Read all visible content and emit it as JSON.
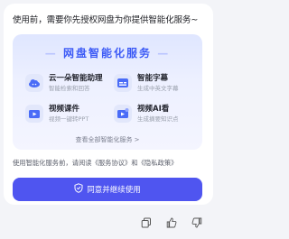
{
  "intro_text": "使用前，需要你先授权网盘为你提供智能化服务~",
  "card": {
    "title": "网盘智能化服务",
    "features": [
      {
        "icon": "cloud-assistant-icon",
        "title": "云一朵智能助理",
        "subtitle": "智能检索和回答"
      },
      {
        "icon": "smart-subtitle-icon",
        "title": "智能字幕",
        "subtitle": "生成中英文字幕"
      },
      {
        "icon": "video-courseware-icon",
        "title": "视频课件",
        "subtitle": "视频一键转PPT"
      },
      {
        "icon": "video-ai-icon",
        "title": "视频AI看",
        "subtitle": "生成摘要知识点"
      }
    ],
    "view_all": "查看全部智能化服务 >"
  },
  "consent": {
    "prefix": "使用智能化服务前，请阅读",
    "service_agreement": "《服务协议》",
    "and": "和",
    "privacy_policy": "《隐私政策》"
  },
  "agree_button": "同意并继续使用",
  "colors": {
    "accent": "#4f55f0",
    "title_blue": "#3d5bf6"
  },
  "action_icons": [
    "copy-icon",
    "thumbs-up-icon",
    "thumbs-down-icon"
  ]
}
